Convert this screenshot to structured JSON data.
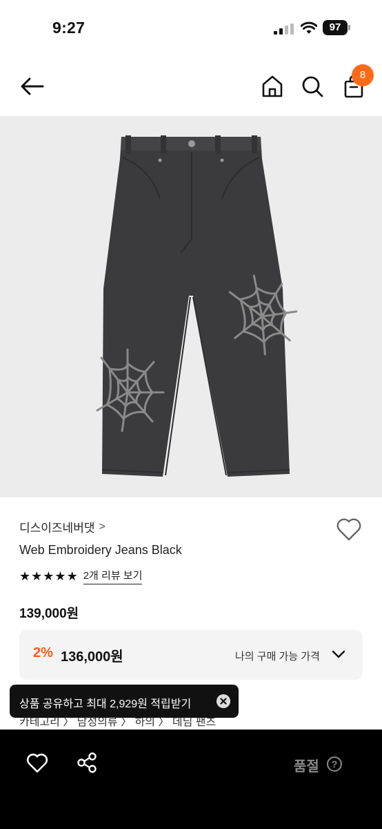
{
  "status_bar": {
    "time": "9:27",
    "battery": "97",
    "icons": [
      "cellular-signal-icon",
      "wifi-icon",
      "battery-icon"
    ]
  },
  "nav": {
    "back_icon": "back-arrow-icon",
    "home_icon": "home-icon",
    "search_icon": "search-icon",
    "cart_icon": "shopping-bag-icon",
    "cart_count": "8",
    "badge_color": "#ff6a1a"
  },
  "product": {
    "image_desc_icon": "jeans-photo",
    "brand": "디스이즈네버댓",
    "brand_chevron": ">",
    "name": "Web Embroidery Jeans Black",
    "rating_stars": 5,
    "stars": [
      "★",
      "★",
      "★",
      "★",
      "★"
    ],
    "review_link": "2개 리뷰 보기",
    "price": "139,000원"
  },
  "discount": {
    "percent": "2%",
    "price": "136,000원",
    "my_price_label": "나의 구매 가능 가격",
    "accent_color": "#ff5a1f"
  },
  "category": {
    "text": "카테고리   〉 남성의류 〉 하의 〉 데님 팬츠"
  },
  "toast": {
    "text": "상품 공유하고 최대 2,929원 적립받기",
    "close_icon": "close-icon",
    "close_glyph": "✕"
  },
  "bottom_bar": {
    "like_icon": "heart-outline-icon",
    "share_icon": "share-icon",
    "status_label": "품절",
    "help_icon": "question-icon",
    "help_glyph": "?"
  }
}
